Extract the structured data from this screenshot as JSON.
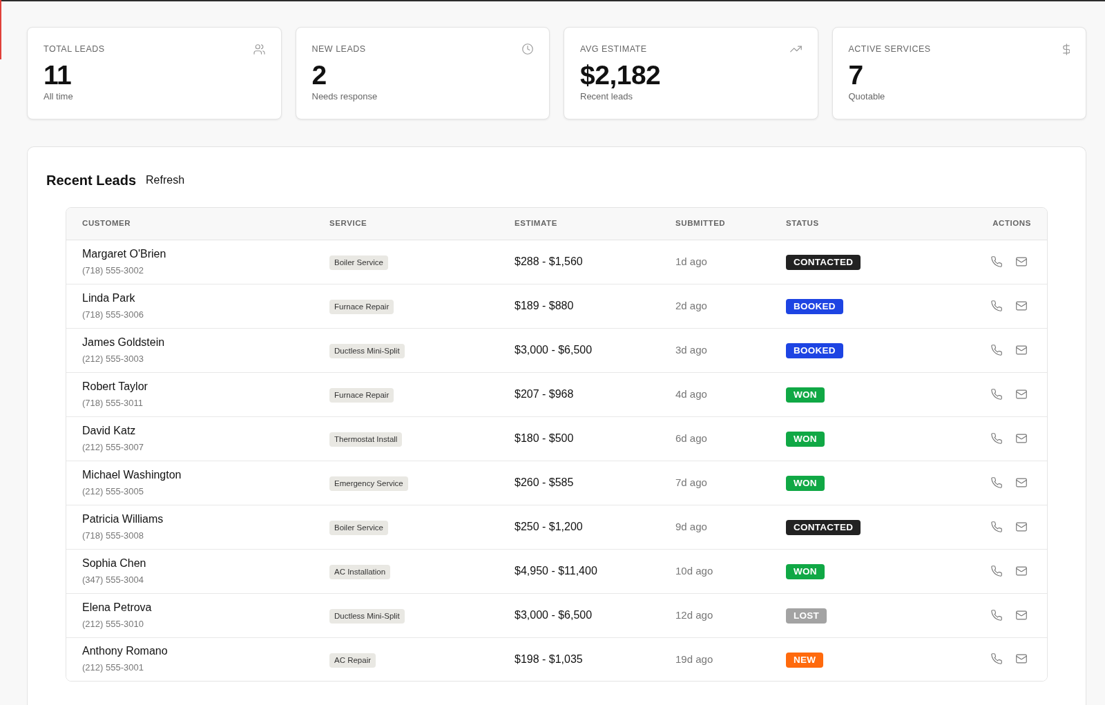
{
  "stats": [
    {
      "label": "TOTAL LEADS",
      "value": "11",
      "caption": "All time"
    },
    {
      "label": "NEW LEADS",
      "value": "2",
      "caption": "Needs response"
    },
    {
      "label": "AVG ESTIMATE",
      "value": "$2,182",
      "caption": "Recent leads"
    },
    {
      "label": "ACTIVE SERVICES",
      "value": "7",
      "caption": "Quotable"
    }
  ],
  "leads_panel": {
    "title": "Recent Leads",
    "refresh_button": "Refresh"
  },
  "table": {
    "columns": [
      "CUSTOMER",
      "SERVICE",
      "ESTIMATE",
      "SUBMITTED",
      "STATUS",
      "ACTIONS"
    ],
    "rows": [
      {
        "customer": "Margaret O'Brien",
        "phone": "(718) 555-3002",
        "service": "Boiler Service",
        "estimate": "$288 - $1,560",
        "submitted": "1d ago",
        "status": {
          "label": "CONTACTED",
          "color": "#222222"
        }
      },
      {
        "customer": "Linda Park",
        "phone": "(718) 555-3006",
        "service": "Furnace Repair",
        "estimate": "$189 - $880",
        "submitted": "2d ago",
        "status": {
          "label": "BOOKED",
          "color": "#1d44e3"
        }
      },
      {
        "customer": "James Goldstein",
        "phone": "(212) 555-3003",
        "service": "Ductless Mini-Split",
        "estimate": "$3,000 - $6,500",
        "submitted": "3d ago",
        "status": {
          "label": "BOOKED",
          "color": "#1d44e3"
        }
      },
      {
        "customer": "Robert Taylor",
        "phone": "(718) 555-3011",
        "service": "Furnace Repair",
        "estimate": "$207 - $968",
        "submitted": "4d ago",
        "status": {
          "label": "WON",
          "color": "#10a845"
        }
      },
      {
        "customer": "David Katz",
        "phone": "(212) 555-3007",
        "service": "Thermostat Install",
        "estimate": "$180 - $500",
        "submitted": "6d ago",
        "status": {
          "label": "WON",
          "color": "#10a845"
        }
      },
      {
        "customer": "Michael Washington",
        "phone": "(212) 555-3005",
        "service": "Emergency Service",
        "estimate": "$260 - $585",
        "submitted": "7d ago",
        "status": {
          "label": "WON",
          "color": "#10a845"
        }
      },
      {
        "customer": "Patricia Williams",
        "phone": "(718) 555-3008",
        "service": "Boiler Service",
        "estimate": "$250 - $1,200",
        "submitted": "9d ago",
        "status": {
          "label": "CONTACTED",
          "color": "#222222"
        }
      },
      {
        "customer": "Sophia Chen",
        "phone": "(347) 555-3004",
        "service": "AC Installation",
        "estimate": "$4,950 - $11,400",
        "submitted": "10d ago",
        "status": {
          "label": "WON",
          "color": "#10a845"
        }
      },
      {
        "customer": "Elena Petrova",
        "phone": "(212) 555-3010",
        "service": "Ductless Mini-Split",
        "estimate": "$3,000 - $6,500",
        "submitted": "12d ago",
        "status": {
          "label": "LOST",
          "color": "#a3a3a3"
        }
      },
      {
        "customer": "Anthony Romano",
        "phone": "(212) 555-3001",
        "service": "AC Repair",
        "estimate": "$198 - $1,035",
        "submitted": "19d ago",
        "status": {
          "label": "NEW",
          "color": "#ff6a0d"
        }
      }
    ]
  }
}
